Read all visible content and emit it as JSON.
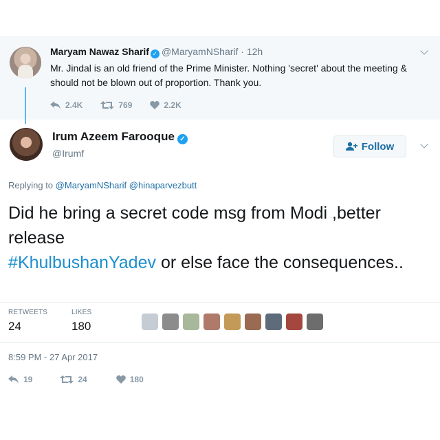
{
  "parent_tweet": {
    "name": "Maryam Nawaz Sharif",
    "handle": "@MaryamNSharif",
    "time": "· 12h",
    "text": "Mr. Jindal is an old friend of the Prime Minister. Nothing 'secret' about the meeting & should not be blown out of proportion. Thank you.",
    "replies": "2.4K",
    "retweets": "769",
    "likes": "2.2K"
  },
  "main_tweet": {
    "name": "Irum Azeem Farooque",
    "handle": "@Irumf",
    "follow_label": "Follow",
    "replying_prefix": "Replying to",
    "replying_to": [
      "@MaryamNSharif",
      "@hinaparvezbutt"
    ],
    "text_part1": "Did he bring a secret code msg from Modi ,better release",
    "hashtag": "#KhulbushanYadev",
    "text_part2": " or else face the consequences..",
    "retweets_label": "RETWEETS",
    "retweets": "24",
    "likes_label": "LIKES",
    "likes": "180",
    "timestamp": "8:59 PM - 27 Apr 2017",
    "action_replies": "19",
    "action_retweets": "24",
    "action_likes": "180"
  },
  "likers": [
    {
      "icon": "default-avatar",
      "color": "#c5ccd3"
    },
    {
      "icon": "user-avatar",
      "color": "#8c8c8c"
    },
    {
      "icon": "user-avatar",
      "color": "#a8b89a"
    },
    {
      "icon": "user-avatar",
      "color": "#b07a6a"
    },
    {
      "icon": "user-avatar",
      "color": "#c49a58"
    },
    {
      "icon": "user-avatar",
      "color": "#9a6a52"
    },
    {
      "icon": "user-avatar",
      "color": "#5e6b7a"
    },
    {
      "icon": "user-avatar",
      "color": "#a4473f"
    },
    {
      "icon": "user-avatar",
      "color": "#6d6d6d"
    }
  ],
  "colors": {
    "link": "#1d6fa5",
    "hashtag": "#1d8fcf",
    "verified": "#1da1f2",
    "muted": "#657786"
  }
}
